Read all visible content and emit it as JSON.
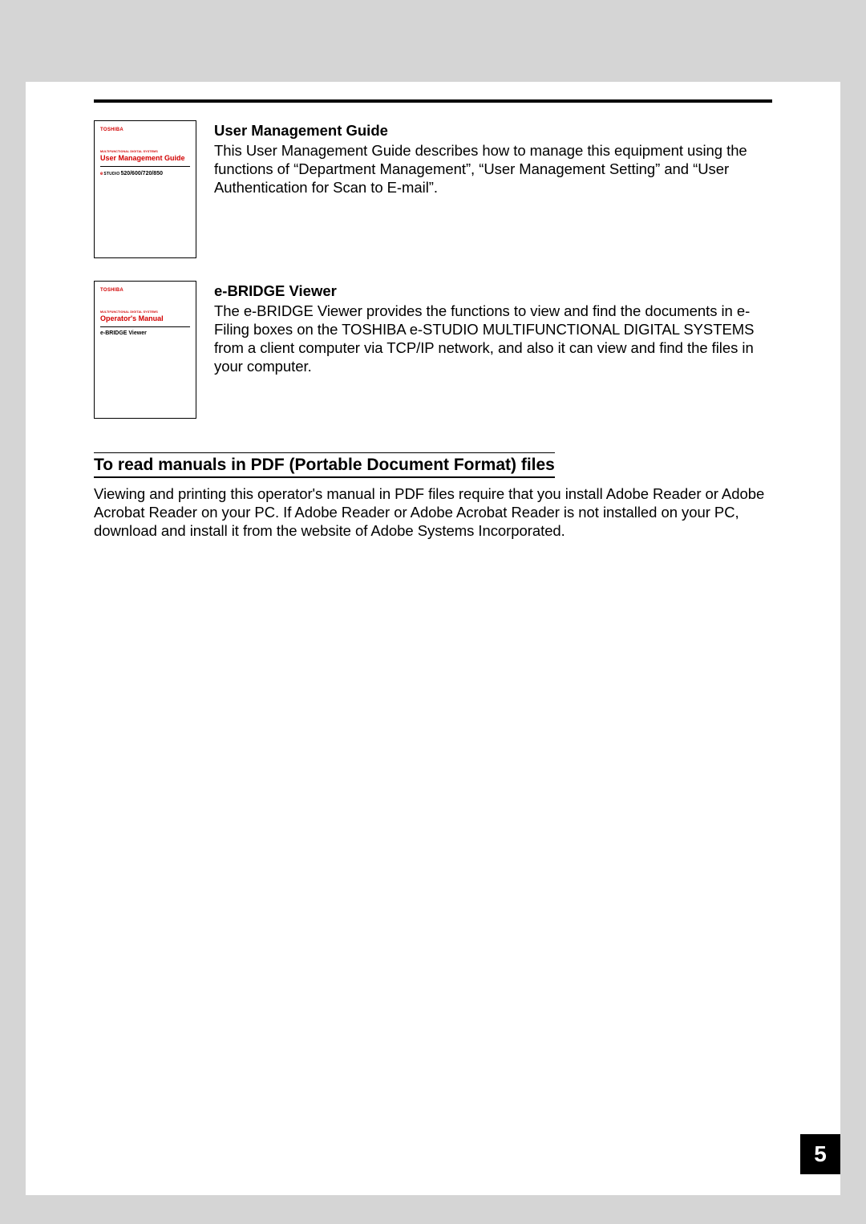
{
  "entries": [
    {
      "thumb": {
        "brand": "TOSHIBA",
        "sub": "MULTIFUNCTIONAL DIGITAL SYSTEMS",
        "title": "User Management Guide",
        "model": "520/600/720/850",
        "eStudio": "STUDIO",
        "subtitle": ""
      },
      "heading": "User Management Guide",
      "body": "This User Management Guide describes how to manage this equipment using the functions of “Department Management”, “User Management Setting” and “User Authentication for Scan to E-mail”."
    },
    {
      "thumb": {
        "brand": "TOSHIBA",
        "sub": "MULTIFUNCTIONAL DIGITAL SYSTEMS",
        "title": "Operator's Manual",
        "model": "",
        "eStudio": "",
        "subtitle": "e-BRIDGE Viewer"
      },
      "heading": "e-BRIDGE Viewer",
      "body": "The e-BRIDGE Viewer provides the functions to view and find the documents in e-Filing boxes on the TOSHIBA e-STUDIO MULTIFUNCTIONAL DIGITAL SYSTEMS from a client computer via TCP/IP network, and also it can view and find the files in your computer."
    }
  ],
  "section": {
    "heading": "To read manuals in PDF (Portable Document Format) files",
    "body": "Viewing and printing this operator's manual in PDF files require that you install Adobe Reader or Adobe Acrobat Reader on your PC. If Adobe Reader or Adobe Acrobat Reader is not installed on your PC, download and install it from the website of Adobe Systems Incorporated."
  },
  "pageNumber": "5"
}
